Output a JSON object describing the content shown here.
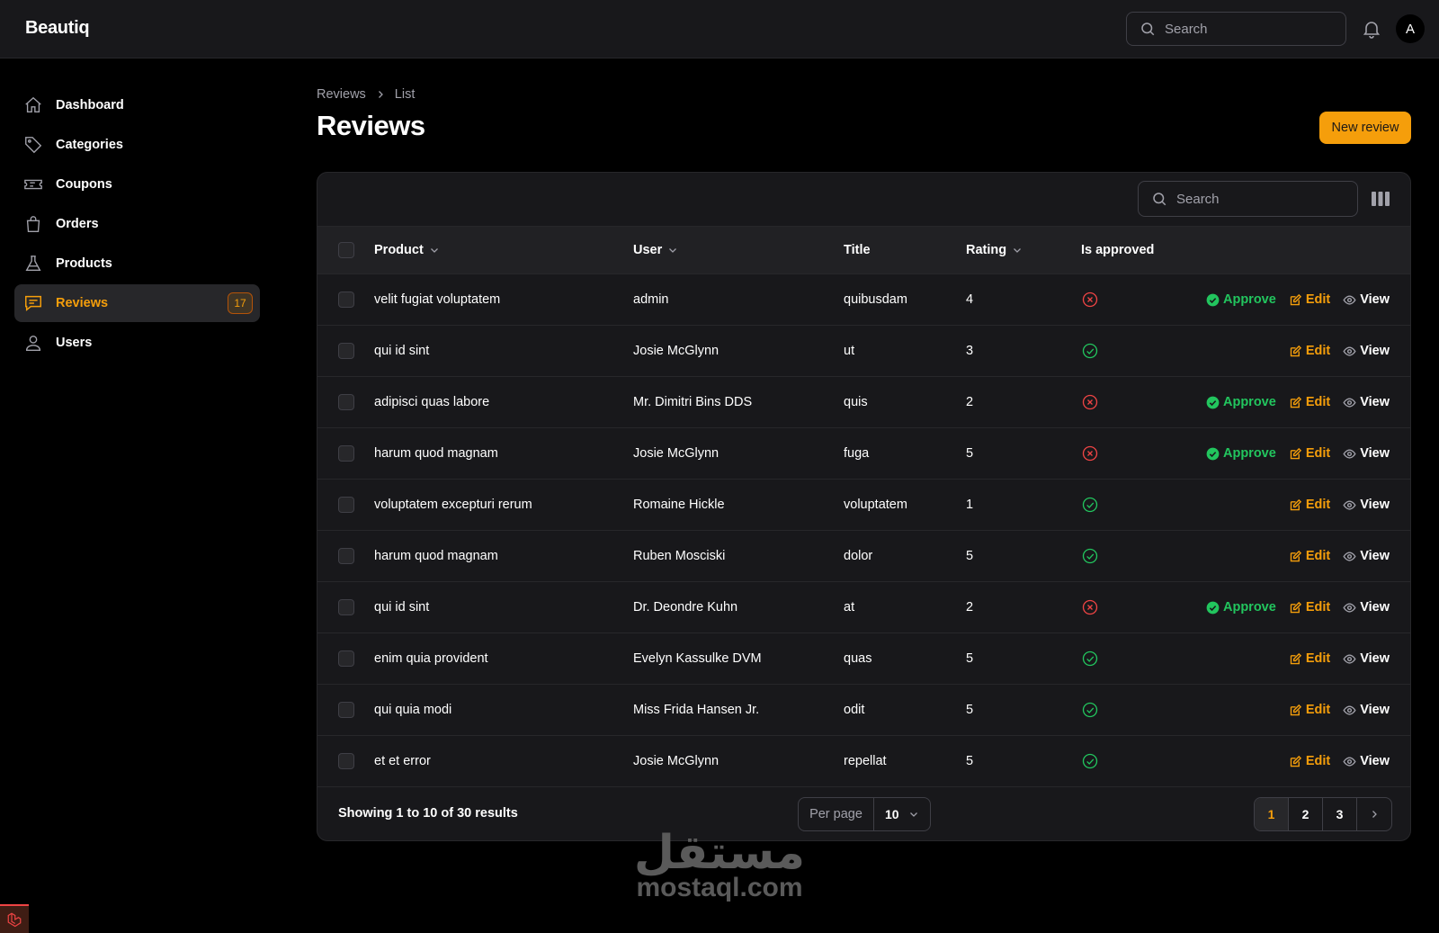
{
  "app": {
    "brand": "Beautiq",
    "avatar_initial": "A",
    "search_placeholder": "Search"
  },
  "sidebar": {
    "items": [
      {
        "label": "Dashboard",
        "icon": "home-icon"
      },
      {
        "label": "Categories",
        "icon": "tag-icon"
      },
      {
        "label": "Coupons",
        "icon": "ticket-icon"
      },
      {
        "label": "Orders",
        "icon": "shopping-bag-icon"
      },
      {
        "label": "Products",
        "icon": "flask-icon"
      },
      {
        "label": "Reviews",
        "icon": "chat-icon",
        "badge": "17",
        "active": true
      },
      {
        "label": "Users",
        "icon": "user-icon"
      }
    ]
  },
  "breadcrumb": {
    "root": "Reviews",
    "current": "List"
  },
  "page": {
    "title": "Reviews",
    "new_button": "New review"
  },
  "table": {
    "search_placeholder": "Search",
    "columns": {
      "product": "Product",
      "user": "User",
      "title": "Title",
      "rating": "Rating",
      "approved": "Is approved"
    },
    "actions": {
      "approve": "Approve",
      "edit": "Edit",
      "view": "View"
    },
    "rows": [
      {
        "product": "velit fugiat voluptatem",
        "user": "admin",
        "title": "quibusdam",
        "rating": "4",
        "approved": false
      },
      {
        "product": "qui id sint",
        "user": "Josie McGlynn",
        "title": "ut",
        "rating": "3",
        "approved": true
      },
      {
        "product": "adipisci quas labore",
        "user": "Mr. Dimitri Bins DDS",
        "title": "quis",
        "rating": "2",
        "approved": false
      },
      {
        "product": "harum quod magnam",
        "user": "Josie McGlynn",
        "title": "fuga",
        "rating": "5",
        "approved": false
      },
      {
        "product": "voluptatem excepturi rerum",
        "user": "Romaine Hickle",
        "title": "voluptatem",
        "rating": "1",
        "approved": true
      },
      {
        "product": "harum quod magnam",
        "user": "Ruben Mosciski",
        "title": "dolor",
        "rating": "5",
        "approved": true
      },
      {
        "product": "qui id sint",
        "user": "Dr. Deondre Kuhn",
        "title": "at",
        "rating": "2",
        "approved": false
      },
      {
        "product": "enim quia provident",
        "user": "Evelyn Kassulke DVM",
        "title": "quas",
        "rating": "5",
        "approved": true
      },
      {
        "product": "qui quia modi",
        "user": "Miss Frida Hansen Jr.",
        "title": "odit",
        "rating": "5",
        "approved": true
      },
      {
        "product": "et et error",
        "user": "Josie McGlynn",
        "title": "repellat",
        "rating": "5",
        "approved": true
      }
    ]
  },
  "footer": {
    "showing": "Showing 1 to 10 of 30 results",
    "per_page_label": "Per page",
    "per_page_value": "10",
    "pages": [
      "1",
      "2",
      "3"
    ],
    "current_page": "1"
  },
  "watermark": {
    "arabic": "مستقل",
    "latin": "mostaql.com"
  },
  "colors": {
    "accent": "#f59e0b",
    "success": "#22c55e",
    "danger": "#ef4444",
    "background": "#000000",
    "surface": "#18181b"
  }
}
